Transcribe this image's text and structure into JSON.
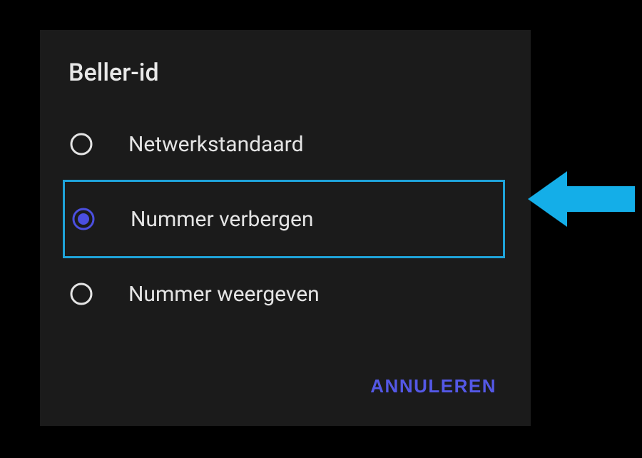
{
  "dialog": {
    "title": "Beller-id",
    "options": [
      {
        "label": "Netwerkstandaard",
        "selected": false,
        "highlighted": false
      },
      {
        "label": "Nummer verbergen",
        "selected": true,
        "highlighted": true
      },
      {
        "label": "Nummer weergeven",
        "selected": false,
        "highlighted": false
      }
    ],
    "cancel_label": "ANNULEREN"
  },
  "colors": {
    "accent": "#4b4fe0",
    "highlight_border": "#1fa3d9",
    "arrow": "#14aee8"
  }
}
